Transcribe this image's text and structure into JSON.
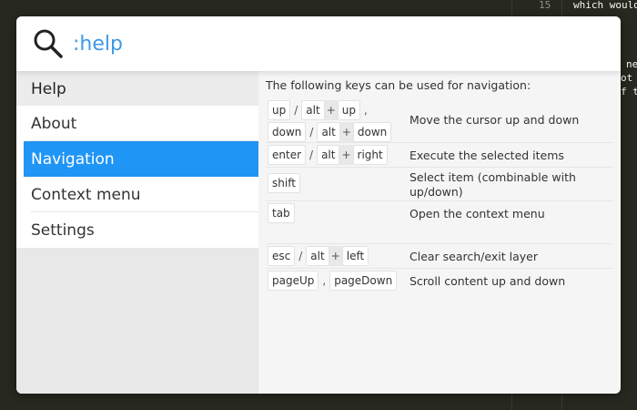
{
  "editor": {
    "line_number": "15",
    "code_lines": [
      "which would",
      "ne",
      "ot",
      "f t"
    ]
  },
  "search": {
    "value": ":help"
  },
  "sidebar": {
    "header": "Help",
    "items": [
      {
        "label": "About"
      },
      {
        "label": "Navigation"
      },
      {
        "label": "Context menu"
      },
      {
        "label": "Settings"
      }
    ],
    "active_index": 1
  },
  "content": {
    "intro": "The following keys can be used for navigation:",
    "rows": [
      {
        "keys": [
          "up",
          "/",
          "alt",
          "+",
          "up",
          ",",
          "down",
          "/",
          "alt",
          "+",
          "down"
        ],
        "description": "Move the cursor up and down"
      },
      {
        "keys": [
          "enter",
          "/",
          "alt",
          "+",
          "right"
        ],
        "description": "Execute the selected items"
      },
      {
        "keys": [
          "shift"
        ],
        "description": "Select item (combinable with up/down)"
      },
      {
        "keys": [
          "tab"
        ],
        "description": "Open the context menu"
      },
      {
        "keys": [
          "esc",
          "/",
          "alt",
          "+",
          "left"
        ],
        "description": "Clear search/exit layer"
      },
      {
        "keys": [
          "pageUp",
          ",",
          "pageDown"
        ],
        "description": "Scroll content up and down"
      }
    ]
  },
  "colors": {
    "accent": "#1f95f6",
    "search_text": "#3c9ae8"
  }
}
